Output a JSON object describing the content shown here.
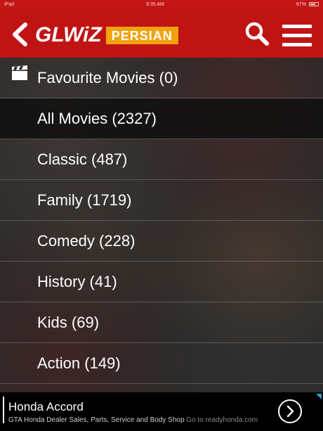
{
  "status": {
    "carrier": "iPad",
    "time": "9:35 AM",
    "battery": "67%"
  },
  "header": {
    "logo": "GLWiZ",
    "badge": "PERSIAN"
  },
  "list": {
    "items": [
      {
        "label": "Favourite Movies (0)",
        "icon": "clapperboard-icon"
      },
      {
        "label": "All Movies (2327)",
        "selected": true
      },
      {
        "label": "Classic (487)"
      },
      {
        "label": "Family (1719)"
      },
      {
        "label": "Comedy (228)"
      },
      {
        "label": "History (41)"
      },
      {
        "label": "Kids (69)"
      },
      {
        "label": "Action (149)"
      }
    ]
  },
  "ad": {
    "title": "Honda Accord",
    "description": "GTA Honda Dealer Sales, Parts, Service and Body Shop",
    "link": "Go to readyhonda.com"
  },
  "colors": {
    "header": "#c01414",
    "badge": "#f2a20d"
  }
}
